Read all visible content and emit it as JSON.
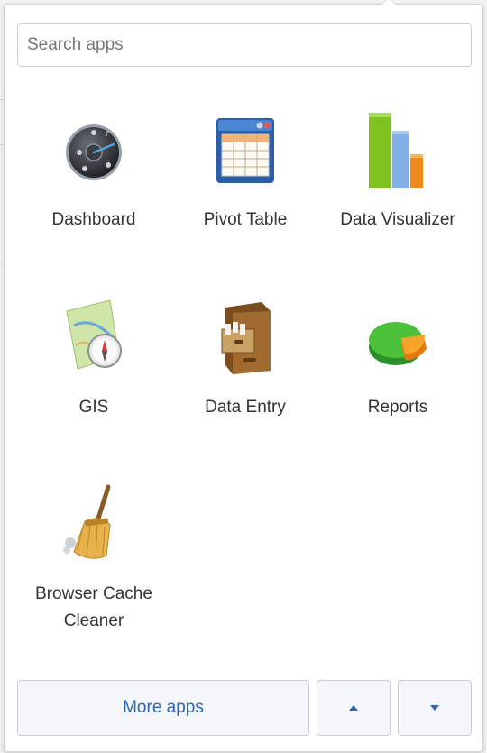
{
  "search": {
    "placeholder": "Search apps",
    "value": ""
  },
  "apps": [
    {
      "label": "Dashboard",
      "icon": "dashboard-icon"
    },
    {
      "label": "Pivot Table",
      "icon": "pivot-table-icon"
    },
    {
      "label": "Data Visualizer",
      "icon": "data-visualizer-icon"
    },
    {
      "label": "GIS",
      "icon": "gis-map-icon"
    },
    {
      "label": "Data Entry",
      "icon": "data-entry-cabinet-icon"
    },
    {
      "label": "Reports",
      "icon": "reports-pie-icon"
    },
    {
      "label": "Browser Cache Cleaner",
      "icon": "broom-icon"
    }
  ],
  "footer": {
    "more_apps_label": "More apps",
    "scroll_up_icon": "caret-up-icon",
    "scroll_down_icon": "caret-down-icon"
  },
  "colors": {
    "accent": "#2f65a7",
    "button_bg": "#f4f6f9",
    "border": "#c9ced6"
  }
}
